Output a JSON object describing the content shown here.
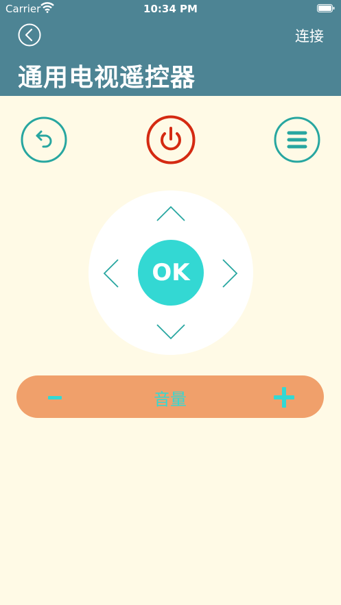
{
  "status_bar": {
    "carrier": "Carrier",
    "time": "10:34 PM"
  },
  "nav": {
    "title": "通用电视遥控器",
    "connect_label": "连接"
  },
  "remote": {
    "ok_label": "OK",
    "volume_label": "音量"
  },
  "colors": {
    "header": "#4d8494",
    "background": "#fffae6",
    "accent_teal": "#33d8d3",
    "icon_teal": "#27a6a0",
    "power_red": "#d42a12",
    "volume_bar": "#f0a06b"
  },
  "icons": [
    "back-icon",
    "return-icon",
    "power-icon",
    "menu-icon",
    "up-arrow-icon",
    "down-arrow-icon",
    "left-arrow-icon",
    "right-arrow-icon",
    "minus-icon",
    "plus-icon"
  ]
}
